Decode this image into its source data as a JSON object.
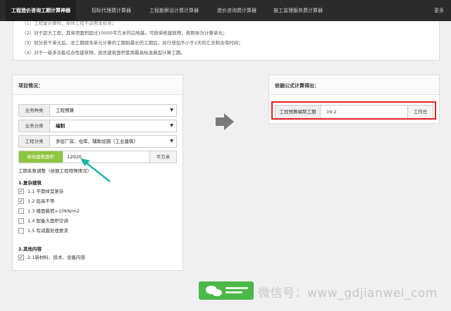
{
  "nav": {
    "tabs": [
      "工程造价咨询工期计算神器",
      "招标代理费计算器",
      "工程勘察设计费计算器",
      "造价咨询费计算器",
      "施工监理服务费计算器"
    ],
    "more": "更多"
  },
  "notes": [
    "（1）工程量计算时，单体工程不适用本标准；",
    "（2）对于超大工程，其单项面积超过10000平方米的白地基，可按单栋建筑物，按照体为计算单元；",
    "（3）划分若干单元后，总工期按各单元计算的工期取最长的工期后，另行增加不小于2天的汇总和合审时间；",
    "（4）对于一级多功能综合性建筑物，按总建筑面积套用最高标准典型计算工期。"
  ],
  "project": {
    "title": "项目情况：",
    "fields": [
      {
        "label": "业务种类",
        "value": "工程预算"
      },
      {
        "label": "业务分类",
        "value": "编制"
      },
      {
        "label": "工程分类",
        "value": "多层厂房、仓库、辅助设施（工业建筑）"
      }
    ],
    "area": {
      "label": "单体建筑面积",
      "value": "12020",
      "unit": "平方米"
    },
    "adjust_note": "工期系数调整（依据工程特殊情况）",
    "groups": [
      {
        "title": "1.复杂建筑",
        "items": [
          {
            "label": "1.1 平面体型复杂",
            "checked": true
          },
          {
            "label": "1.2 层高不等",
            "checked": true
          },
          {
            "label": "1.3 楼面载荷>10KN/m2",
            "checked": false
          },
          {
            "label": "1.4 配备大面积空调",
            "checked": false
          },
          {
            "label": "1.5 有减震处理要求",
            "checked": false
          }
        ]
      },
      {
        "title": "2.其他内容",
        "items": [
          {
            "label": "2.1新材料、技术、设备内容",
            "checked": true
          }
        ]
      }
    ]
  },
  "result": {
    "title": "依据公式计算得出：",
    "label": "工程预算编制工期",
    "value": "19.2",
    "unit": "工作日"
  },
  "watermark": {
    "text": "微信号：www_gdjianwei_com"
  },
  "colors": {
    "accent_green": "#8dc63f",
    "highlight_red": "#e02020",
    "nav_bg": "#2b2b2b"
  }
}
